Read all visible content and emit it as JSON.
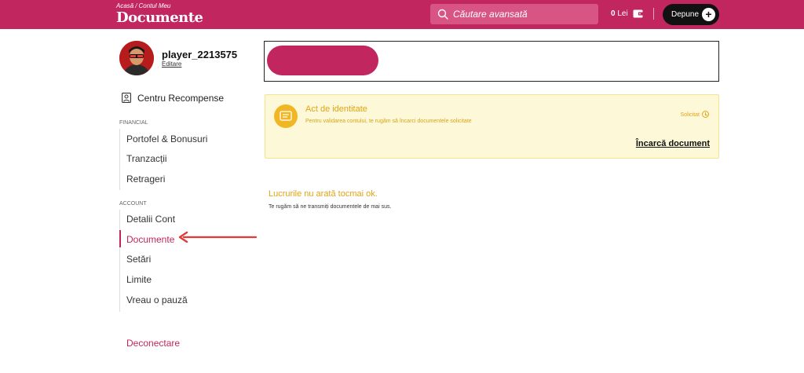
{
  "header": {
    "breadcrumb": [
      "Acasă",
      "/",
      "Contul Meu"
    ],
    "title": "Documente",
    "search_placeholder": "Căutare avansată",
    "balance_amount": "0",
    "balance_currency": "Lei",
    "deposit_label": "Depune",
    "deposit_plus": "+"
  },
  "colors": {
    "brand": "#c2265f",
    "warning": "#e0a417",
    "warning_bg": "#fdf8d7"
  },
  "sidebar": {
    "username": "player_2213575",
    "edit_label": "Editare",
    "rewards_label": "Centru Recompense",
    "financial_label": "FINANCIAL",
    "financial_items": [
      "Portofel & Bonusuri",
      "Tranzacții",
      "Retrageri"
    ],
    "account_label": "ACCOUNT",
    "account_items": [
      "Detalii Cont",
      "Documente",
      "Setări",
      "Limite",
      "Vreau o pauză"
    ],
    "active_item": "Documente",
    "logout_label": "Deconectare"
  },
  "document": {
    "title": "Act de identitate",
    "description": "Pentru validarea contului, te rugăm să încarci documentele solicitate",
    "status": "Solicitat",
    "upload_label": "Încarcă document"
  },
  "notice": {
    "title": "Lucrurile nu arată tocmai ok.",
    "text": "Te rugăm să ne transmiți documentele de mai sus."
  }
}
